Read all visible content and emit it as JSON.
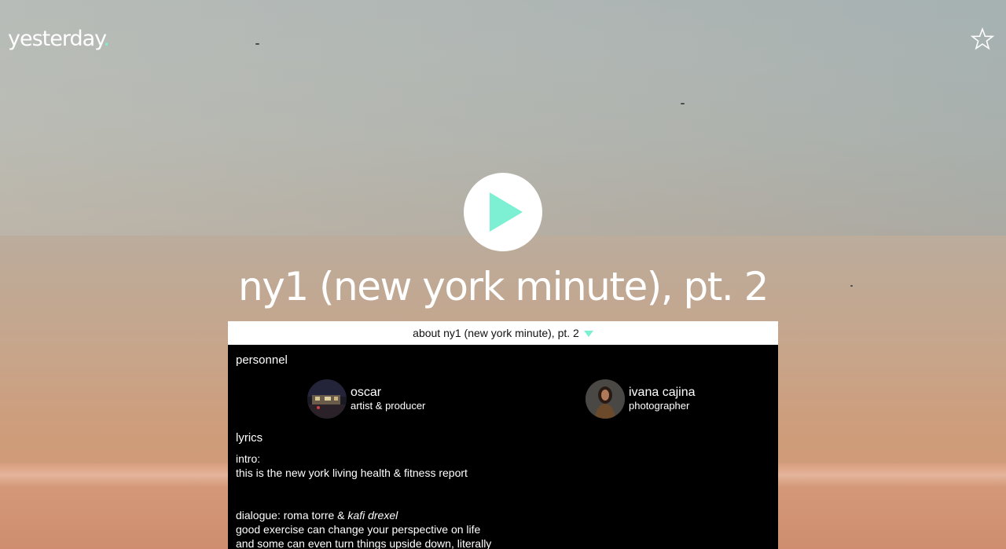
{
  "brand": {
    "name": "yesterday",
    "dot": ".",
    "accent_color": "#7df0d4"
  },
  "header": {
    "favorite_icon": "star-outline-icon"
  },
  "player": {
    "play_icon": "play-icon"
  },
  "song": {
    "title": "ny1 (new york minute), pt. 2"
  },
  "about": {
    "label": "about ny1 (new york minute), pt. 2",
    "toggle_icon": "caret-down-icon"
  },
  "personnel": {
    "heading": "personnel",
    "people": [
      {
        "name": "oscar",
        "role": "artist & producer"
      },
      {
        "name": "ivana cajina",
        "role": "photographer"
      }
    ]
  },
  "lyrics": {
    "heading": "lyrics",
    "intro_label": "intro:",
    "intro_line": "this is the new york living health & fitness report",
    "dialogue_label": "dialogue: roma torre & ",
    "dialogue_speaker": "kafi drexel",
    "dialogue_line1": "good exercise can change your perspective on life",
    "dialogue_line2": "and some can even turn things upside down, literally"
  }
}
